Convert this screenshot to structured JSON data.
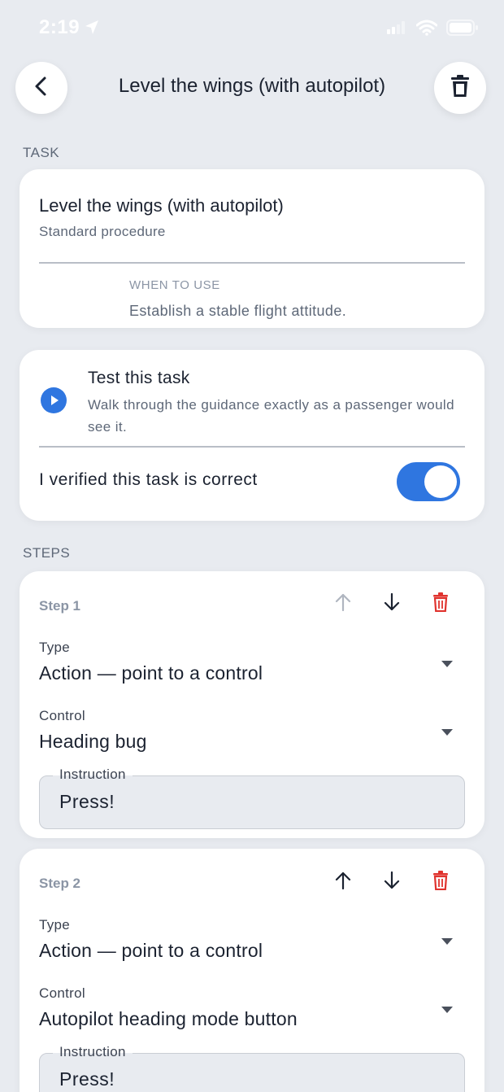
{
  "status_bar": {
    "time": "2:19"
  },
  "header": {
    "title": "Level the wings (with autopilot)"
  },
  "task_section": {
    "label": "TASK",
    "name": "Level the wings (with autopilot)",
    "subtitle": "Standard procedure",
    "when_label": "WHEN TO USE",
    "when_text": "Establish a stable flight attitude."
  },
  "test_card": {
    "title": "Test this task",
    "description": "Walk through the guidance exactly as a passenger would see it.",
    "verify_label": "I verified this task is correct",
    "verified": true
  },
  "steps_section": {
    "label": "STEPS",
    "steps": [
      {
        "label": "Step 1",
        "type_label": "Type",
        "type_value": "Action — point to a control",
        "control_label": "Control",
        "control_value": "Heading bug",
        "instruction_label": "Instruction",
        "instruction_value": "Press!",
        "move_up_enabled": false
      },
      {
        "label": "Step 2",
        "type_label": "Type",
        "type_value": "Action — point to a control",
        "control_label": "Control",
        "control_value": "Autopilot heading mode button",
        "instruction_label": "Instruction",
        "instruction_value": "Press!",
        "move_up_enabled": true
      }
    ]
  },
  "colors": {
    "background": "#e8ebf0",
    "accent": "#2f76e0",
    "danger": "#e0332e",
    "muted": "#8b95a5"
  },
  "icons": {
    "back": "chevron-left-icon",
    "delete": "trash-icon",
    "play": "play-circle-icon",
    "up": "arrow-up-icon",
    "down": "arrow-down-icon",
    "dropdown": "caret-down-icon"
  }
}
